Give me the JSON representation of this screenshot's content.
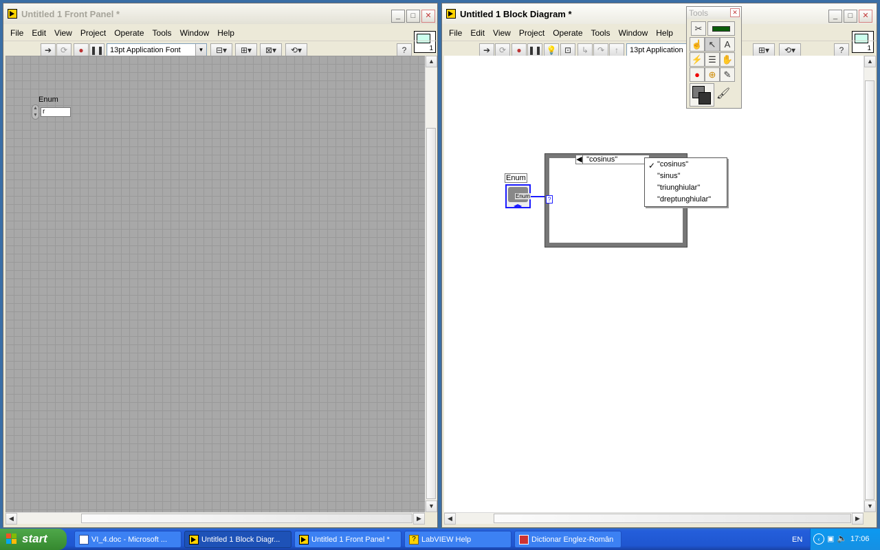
{
  "front_panel": {
    "title": "Untitled 1 Front Panel *",
    "menu": [
      "File",
      "Edit",
      "View",
      "Project",
      "Operate",
      "Tools",
      "Window",
      "Help"
    ],
    "font_selector": "13pt Application Font",
    "enum_label": "Enum",
    "enum_value": "r"
  },
  "block_diagram": {
    "title": "Untitled 1 Block Diagram *",
    "menu": [
      "File",
      "Edit",
      "View",
      "Project",
      "Operate",
      "Tools",
      "Window",
      "Help"
    ],
    "font_selector": "13pt Application Font",
    "enum_label": "Enum",
    "enum_terminal_text": "Enum",
    "case_selector": "\"cosinus\"",
    "case_dropdown": [
      "\"cosinus\"",
      "\"sinus\"",
      "\"triunghiular\"",
      "\"dreptunghiular\""
    ],
    "selected_case": "\"cosinus\"",
    "selector_terminal": "?"
  },
  "tools_palette": {
    "title": "Tools"
  },
  "taskbar": {
    "start_label": "start",
    "tasks": [
      "VI_4.doc - Microsoft ...",
      "Untitled 1 Block Diagr...",
      "Untitled 1 Front Panel *",
      "LabVIEW Help",
      "Dictionar Englez-Român"
    ],
    "language": "EN",
    "clock": "17:06"
  },
  "colors": {
    "enum_terminal_border": "#0000ff",
    "case_border": "#555555",
    "taskbar": "#245edb",
    "start_button": "#3c9e34"
  }
}
